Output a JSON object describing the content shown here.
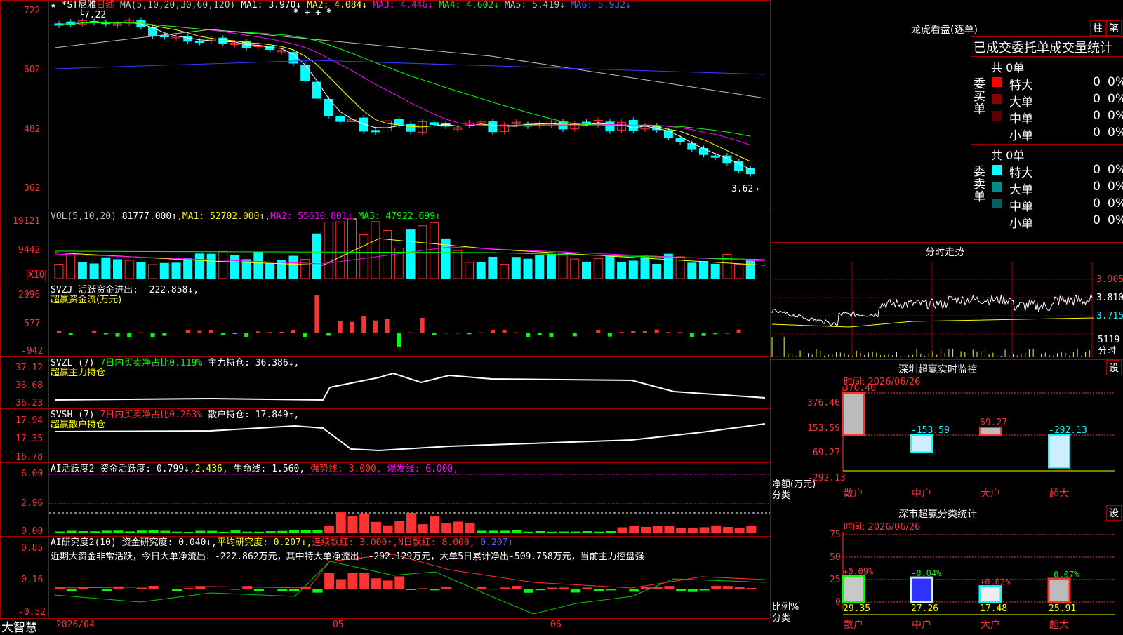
{
  "colors": {
    "up": "#ff3232",
    "down": "#00ffff",
    "ma1": "#ffffff",
    "ma2": "#ffff00",
    "ma3": "#ff00ff",
    "ma4": "#00ff00",
    "ma5": "#c0c0c0",
    "ma6": "#3a3aff",
    "border": "#a00000"
  },
  "main": {
    "star": "★",
    "stock_name": "*ST尼雅",
    "period": "日线",
    "ma_params": "MA(5,10,20,30,60,120)",
    "ma1": "MA1: 3.970↓",
    "ma2": "MA2: 4.084↓",
    "ma3": "MA3: 4.446↓",
    "ma4": "MA4: 4.602↓",
    "ma5": "MA5: 5.419↓",
    "ma6": "MA6: 5.932↓",
    "high_label": "7.22",
    "low_label": "3.62",
    "yticks": [
      "722",
      "602",
      "482",
      "362"
    ],
    "markers": "* + + *"
  },
  "vol": {
    "title": "VOL(5,10,20)",
    "value": "81777.000↑",
    "ma1": "MA1: 52702.000↑",
    "ma2": "MA2: 55610.801↑",
    "ma3": "MA3: 47922.699↑",
    "yticks": [
      "19121",
      "9442"
    ],
    "unit": "X10"
  },
  "svzj": {
    "title": "SVZJ  活跃资金进出: -222.858↓,",
    "sub": "超赢资金流(万元)",
    "yticks": [
      "2096",
      "577",
      "-942"
    ]
  },
  "svzl": {
    "title": "SVZL  (7)",
    "ratio": "7日内买卖净占比0.119%",
    "hold": "主力持仓: 36.386↓,",
    "sub": "超赢主力持仓",
    "yticks": [
      "37.12",
      "36.68",
      "36.23"
    ]
  },
  "svsh": {
    "title": "SVSH  (7)",
    "ratio": "7日内买卖净占比0.263%",
    "hold": "散户持仓: 17.849↑,",
    "sub": "超赢散户持仓",
    "yticks": [
      "17.94",
      "17.35",
      "16.78"
    ]
  },
  "ai1": {
    "title": "AI活跃度2 资金活跃度: 0.799↓,",
    "v2": "2.436,",
    "life": "生命线: 1.560,",
    "strong": "强势线: 3.000,",
    "burst": "爆发线: 6.000,",
    "yticks": [
      "6.00",
      "2.96",
      "0.00"
    ]
  },
  "ai2": {
    "title": "AI研究度2(10) 资金研究度: 0.040↓,",
    "avg": "平均研究度: 0.207↓,",
    "cont": "连续飘红: 3.000↑,",
    "nday": "N日飘红: 8.000,",
    "last": "0.207↓",
    "text": "近期大资金非常活跃，今日大单净流出：-222.862万元，其中特大单净流出：-292.129万元，大单5日累计净出-509.758万元，当前主力控盘强",
    "yticks": [
      "0.85",
      "0.16",
      "-0.52"
    ]
  },
  "xaxis": {
    "d1": "2026/04",
    "d2": "05",
    "d3": "06"
  },
  "logo": "大智慧",
  "right": {
    "lhb_title": "龙虎看盘(逐单)",
    "btn1": "柱",
    "btn2": "笔",
    "order_title": "已成交委托单成交量统计",
    "buy": {
      "side": "委买单",
      "total": "共 0单",
      "rows": [
        {
          "name": "特大",
          "n": "0",
          "p": "0%",
          "c": "#ff0000"
        },
        {
          "name": "大单",
          "n": "0",
          "p": "0%",
          "c": "#8b0000"
        },
        {
          "name": "中单",
          "n": "0",
          "p": "0%",
          "c": "#5a0000"
        },
        {
          "name": "小单",
          "n": "0",
          "p": "0%",
          "c": "#000"
        }
      ]
    },
    "sell": {
      "side": "委卖单",
      "total": "共 0单",
      "rows": [
        {
          "name": "特大",
          "n": "0",
          "p": "0%",
          "c": "#00ffff"
        },
        {
          "name": "大单",
          "n": "0",
          "p": "0%",
          "c": "#008b8b"
        },
        {
          "name": "中单",
          "n": "0",
          "p": "0%",
          "c": "#006060"
        },
        {
          "name": "小单",
          "n": "0",
          "p": "0%",
          "c": "#000"
        }
      ]
    },
    "fs_title": "分时走势",
    "fs_yticks": [
      "3.905",
      "3.810",
      "3.715"
    ],
    "fs_vol": "5119",
    "fs_unit": "分时",
    "mon_title": "深圳超赢实时监控",
    "mon_btn": "设",
    "mon_time": "时间: 2026/06/26",
    "mon_yticks": [
      "376.46",
      "153.59",
      "-69.27",
      "-292.13"
    ],
    "mon_unit": "净额(万元)",
    "mon_cat": "分类",
    "mon_bars": [
      {
        "label": "散户",
        "value": 376.46,
        "text": "376.46"
      },
      {
        "label": "中户",
        "value": -153.59,
        "text": "-153.59"
      },
      {
        "label": "大户",
        "value": 69.27,
        "text": "69.27"
      },
      {
        "label": "超大",
        "value": -292.13,
        "text": "-292.13"
      }
    ],
    "cls_title": "深市超赢分类统计",
    "cls_btn": "设",
    "cls_time": "时间: 2026/06/26",
    "cls_yticks": [
      "75",
      "50",
      "25",
      "0"
    ],
    "cls_unit": "比例%",
    "cls_cat": "分类",
    "cls_bars": [
      {
        "label": "散户",
        "value": 29.35,
        "text": "29.35",
        "chg": "+0.09%"
      },
      {
        "label": "中户",
        "value": 27.26,
        "text": "27.26",
        "chg": "-0.04%"
      },
      {
        "label": "大户",
        "value": 17.48,
        "text": "17.48",
        "chg": "+0.02%"
      },
      {
        "label": "超大",
        "value": 25.91,
        "text": "25.91",
        "chg": "-0.07%"
      }
    ]
  }
}
